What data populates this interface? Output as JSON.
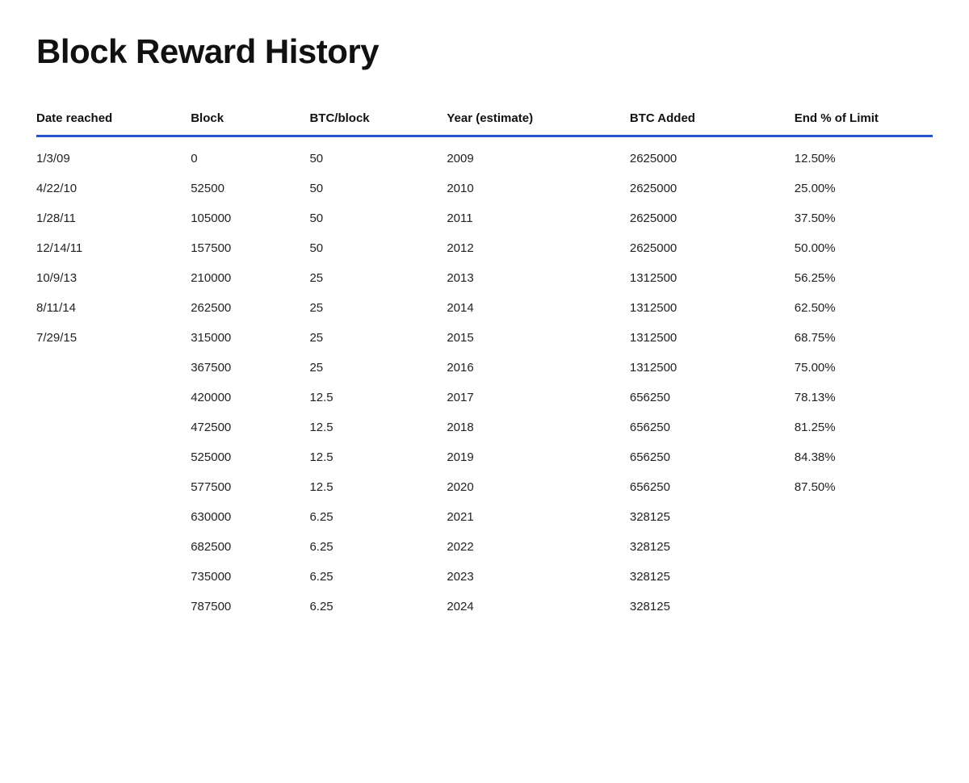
{
  "title": "Block Reward History",
  "columns": [
    {
      "id": "date",
      "label": "Date reached"
    },
    {
      "id": "block",
      "label": "Block"
    },
    {
      "id": "btcblock",
      "label": "BTC/block"
    },
    {
      "id": "year",
      "label": "Year (estimate)"
    },
    {
      "id": "btcadded",
      "label": "BTC Added"
    },
    {
      "id": "endlimit",
      "label": "End % of Limit"
    }
  ],
  "rows": [
    {
      "date": "1/3/09",
      "block": "0",
      "btcblock": "50",
      "year": "2009",
      "btcadded": "2625000",
      "endlimit": "12.50%"
    },
    {
      "date": "4/22/10",
      "block": "52500",
      "btcblock": "50",
      "year": "2010",
      "btcadded": "2625000",
      "endlimit": "25.00%"
    },
    {
      "date": "1/28/11",
      "block": "105000",
      "btcblock": "50",
      "year": "2011",
      "btcadded": "2625000",
      "endlimit": "37.50%"
    },
    {
      "date": "12/14/11",
      "block": "157500",
      "btcblock": "50",
      "year": "2012",
      "btcadded": "2625000",
      "endlimit": "50.00%"
    },
    {
      "date": "10/9/13",
      "block": "210000",
      "btcblock": "25",
      "year": "2013",
      "btcadded": "1312500",
      "endlimit": "56.25%"
    },
    {
      "date": "8/11/14",
      "block": "262500",
      "btcblock": "25",
      "year": "2014",
      "btcadded": "1312500",
      "endlimit": "62.50%"
    },
    {
      "date": "7/29/15",
      "block": "315000",
      "btcblock": "25",
      "year": "2015",
      "btcadded": "1312500",
      "endlimit": "68.75%"
    },
    {
      "date": "",
      "block": "367500",
      "btcblock": "25",
      "year": "2016",
      "btcadded": "1312500",
      "endlimit": "75.00%"
    },
    {
      "date": "",
      "block": "420000",
      "btcblock": "12.5",
      "year": "2017",
      "btcadded": "656250",
      "endlimit": "78.13%"
    },
    {
      "date": "",
      "block": "472500",
      "btcblock": "12.5",
      "year": "2018",
      "btcadded": "656250",
      "endlimit": "81.25%"
    },
    {
      "date": "",
      "block": "525000",
      "btcblock": "12.5",
      "year": "2019",
      "btcadded": "656250",
      "endlimit": "84.38%"
    },
    {
      "date": "",
      "block": "577500",
      "btcblock": "12.5",
      "year": "2020",
      "btcadded": "656250",
      "endlimit": "87.50%"
    },
    {
      "date": "",
      "block": "630000",
      "btcblock": "6.25",
      "year": "2021",
      "btcadded": "328125",
      "endlimit": ""
    },
    {
      "date": "",
      "block": "682500",
      "btcblock": "6.25",
      "year": "2022",
      "btcadded": "328125",
      "endlimit": ""
    },
    {
      "date": "",
      "block": "735000",
      "btcblock": "6.25",
      "year": "2023",
      "btcadded": "328125",
      "endlimit": ""
    },
    {
      "date": "",
      "block": "787500",
      "btcblock": "6.25",
      "year": "2024",
      "btcadded": "328125",
      "endlimit": ""
    }
  ]
}
